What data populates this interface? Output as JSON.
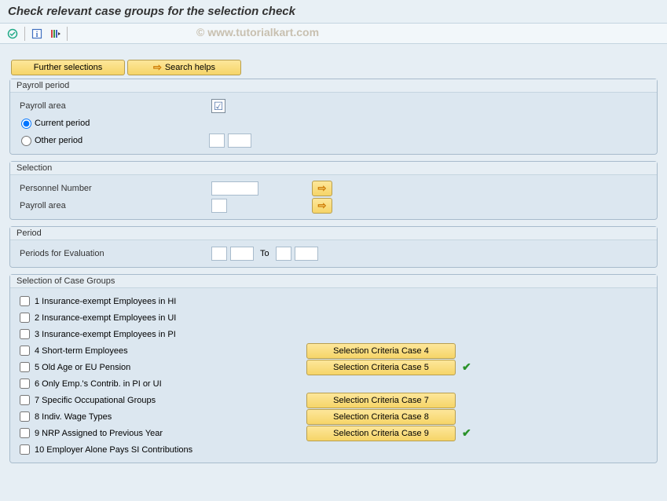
{
  "title": "Check relevant case groups for the selection check",
  "watermark": "© www.tutorialkart.com",
  "buttons": {
    "further_selections": "Further selections",
    "search_helps": "Search helps"
  },
  "groups": {
    "payroll_period": {
      "title": "Payroll period",
      "payroll_area_label": "Payroll area",
      "current_period": "Current period",
      "other_period": "Other period"
    },
    "selection": {
      "title": "Selection",
      "personnel_number": "Personnel Number",
      "payroll_area": "Payroll area"
    },
    "period": {
      "title": "Period",
      "periods_for_evaluation": "Periods for Evaluation",
      "to": "To"
    },
    "case_groups": {
      "title": "Selection of Case Groups",
      "items": [
        {
          "label": "1 Insurance-exempt Employees in HI",
          "button": "",
          "checked": false
        },
        {
          "label": "2 Insurance-exempt Employees in UI",
          "button": "",
          "checked": false
        },
        {
          "label": "3 Insurance-exempt Employees in PI",
          "button": "",
          "checked": false
        },
        {
          "label": "4 Short-term Employees",
          "button": "Selection Criteria Case 4",
          "checked": false
        },
        {
          "label": "5 Old Age or EU Pension",
          "button": "Selection Criteria Case 5",
          "checked": true
        },
        {
          "label": "6 Only Emp.'s Contrib. in PI or UI",
          "button": "",
          "checked": false
        },
        {
          "label": "7 Specific Occupational Groups",
          "button": "Selection Criteria Case 7",
          "checked": false
        },
        {
          "label": "8 Indiv. Wage Types",
          "button": "Selection Criteria Case 8",
          "checked": false
        },
        {
          "label": "9 NRP Assigned to Previous Year",
          "button": "Selection Criteria Case 9",
          "checked": true
        },
        {
          "label": "10 Employer Alone Pays SI Contributions",
          "button": "",
          "checked": false
        }
      ]
    }
  }
}
